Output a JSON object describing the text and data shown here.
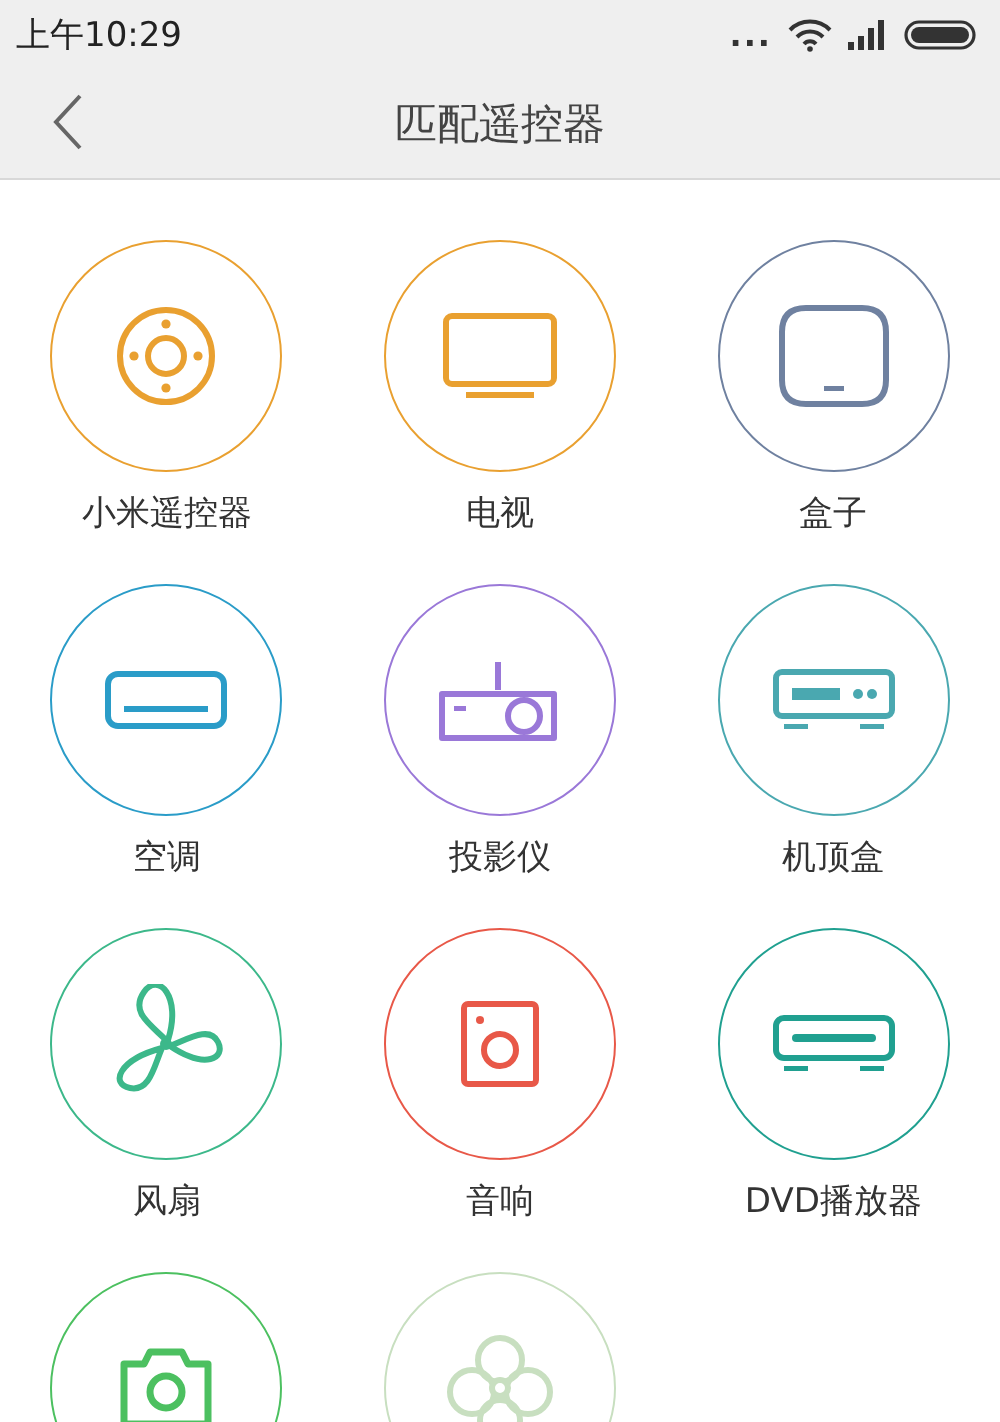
{
  "status_bar": {
    "time": "上午10:29",
    "dots": "..."
  },
  "header": {
    "title": "匹配遥控器"
  },
  "devices": [
    {
      "kind": "remote",
      "label": "小米遥控器",
      "color": "#e9a030"
    },
    {
      "kind": "tv",
      "label": "电视",
      "color": "#e9a030"
    },
    {
      "kind": "box",
      "label": "盒子",
      "color": "#6f81a0"
    },
    {
      "kind": "ac",
      "label": "空调",
      "color": "#2a9cc8"
    },
    {
      "kind": "projector",
      "label": "投影仪",
      "color": "#9a78d8"
    },
    {
      "kind": "settopbox",
      "label": "机顶盒",
      "color": "#4aa8b0"
    },
    {
      "kind": "fan",
      "label": "风扇",
      "color": "#3cb88a"
    },
    {
      "kind": "speaker",
      "label": "音响",
      "color": "#e85848"
    },
    {
      "kind": "dvd",
      "label": "DVD播放器",
      "color": "#20a090"
    },
    {
      "kind": "camera",
      "color": "#4cc060"
    },
    {
      "kind": "flower",
      "color": "#c8dfc0"
    }
  ]
}
